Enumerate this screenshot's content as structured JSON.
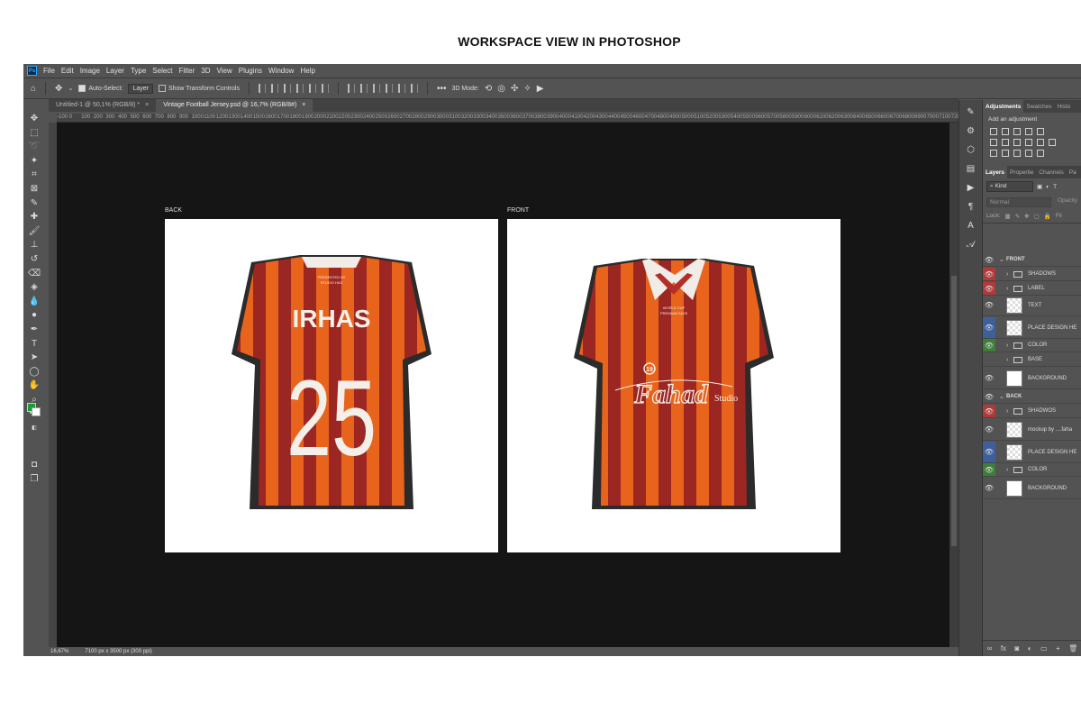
{
  "page_title": "WORKSPACE VIEW IN PHOTOSHOP",
  "app_logo": "Ps",
  "menu": [
    "File",
    "Edit",
    "Image",
    "Layer",
    "Type",
    "Select",
    "Filter",
    "3D",
    "View",
    "Plugins",
    "Window",
    "Help"
  ],
  "options": {
    "auto_select_label": "Auto-Select:",
    "auto_select_value": "Layer",
    "transform_label": "Show Transform Controls",
    "mode_label": "3D Mode:"
  },
  "tabs": [
    {
      "label": "Untitled-1 @ 50,1% (RGB/8) *",
      "close": "×"
    },
    {
      "label": "Vintage Football Jersey.psd @ 16,7% (RGB/8#)",
      "close": "×"
    }
  ],
  "ruler_ticks": [
    "-100",
    "0",
    "100",
    "200",
    "300",
    "400",
    "500",
    "600",
    "700",
    "800",
    "900",
    "1000",
    "1100",
    "1200",
    "1300",
    "1400",
    "1500",
    "1600",
    "1700",
    "1800",
    "1900",
    "2000",
    "2100",
    "2200",
    "2300",
    "2400",
    "2500",
    "2600",
    "2700",
    "2800",
    "2900",
    "3000",
    "3100",
    "3200",
    "3300",
    "3400",
    "3500",
    "3600",
    "3700",
    "3800",
    "3900",
    "4000",
    "4100",
    "4200",
    "4300",
    "4400",
    "4500",
    "4600",
    "4700",
    "4800",
    "4900",
    "5000",
    "5100",
    "5200",
    "5300",
    "5400",
    "5500",
    "5600",
    "5700",
    "5800",
    "5900",
    "6000",
    "6100",
    "6200",
    "6300",
    "6400",
    "6500",
    "6600",
    "6700",
    "6800",
    "6900",
    "7000",
    "7100",
    "7200"
  ],
  "artboards": {
    "back_label": "BACK",
    "front_label": "FRONT"
  },
  "jersey": {
    "back_name": "IRHAS",
    "back_number": "25",
    "front_script": "Fahad",
    "front_brand": "Studio",
    "front_crest": "19",
    "colors": {
      "orange": "#e8641c",
      "maroon": "#9b2622",
      "collar": "#f1ece7",
      "side": "#2b2b2b"
    }
  },
  "status": {
    "zoom": "16,67%",
    "doc_size": "7100 px x 3500 px (300 ppi)"
  },
  "panels": {
    "tabs": [
      "Adjustments",
      "Swatches",
      "Histo"
    ],
    "add_adjustment": "Add an adjustment",
    "layer_tabs": [
      "Layers",
      "Propertie",
      "Channels",
      "Pa"
    ],
    "kind": "Kind",
    "blend_mode": "Normal",
    "opacity": "Opacity",
    "lock": "Lock:",
    "fill": "Fil"
  },
  "layers": [
    {
      "name": "FRONT",
      "type": "group-open",
      "eye": "normal"
    },
    {
      "name": "SHADOWS",
      "type": "folder",
      "eye": "red"
    },
    {
      "name": "LABEL",
      "type": "folder",
      "eye": "red"
    },
    {
      "name": "TEXT",
      "type": "layer",
      "eye": "normal"
    },
    {
      "name": "PLACE DESIGN HE",
      "type": "layer",
      "eye": "blue"
    },
    {
      "name": "COLOR",
      "type": "folder",
      "eye": "green"
    },
    {
      "name": "BASE",
      "type": "folder",
      "eye": "off"
    },
    {
      "name": "BACKGROUND",
      "type": "solid",
      "eye": "normal"
    },
    {
      "name": "BACK",
      "type": "group-open",
      "eye": "normal"
    },
    {
      "name": "SHADWOS",
      "type": "folder",
      "eye": "red"
    },
    {
      "name": "mockup by ....faha",
      "type": "layer",
      "eye": "normal"
    },
    {
      "name": "PLACE DESIGN HE",
      "type": "layer",
      "eye": "blue"
    },
    {
      "name": "COLOR",
      "type": "folder",
      "eye": "green"
    },
    {
      "name": "BACKGROUND",
      "type": "solid",
      "eye": "normal"
    }
  ]
}
